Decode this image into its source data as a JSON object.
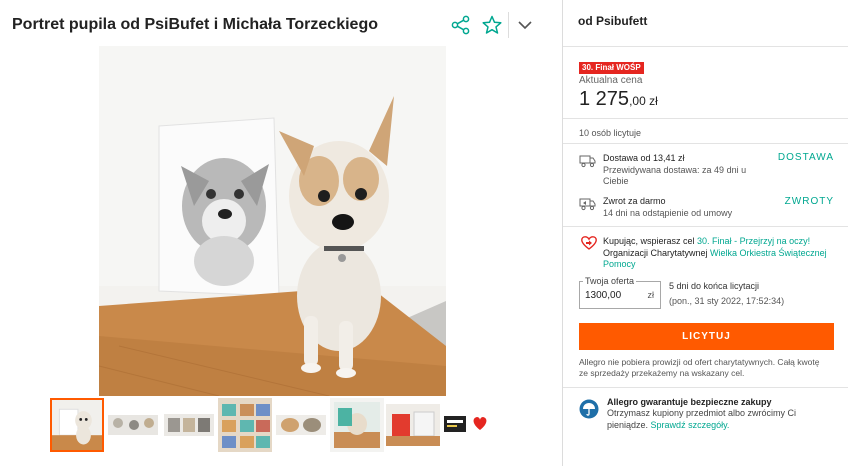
{
  "title": "Portret pupila od PsiBufet i Michała Torzeckiego",
  "header_icons": [
    "share-icon",
    "star-icon",
    "chevron-down-icon"
  ],
  "seller": "od Psibufett",
  "badge": "30. Finał WOŚP",
  "price_label": "Aktualna cena",
  "price": {
    "whole": "1 275",
    "fraction": ",00 zł"
  },
  "bidders": "10 osób licytuje",
  "delivery": {
    "title": "Dostawa od 13,41 zł",
    "sub": "Przewidywana dostawa: za 49 dni u Ciebie",
    "link": "DOSTAWA"
  },
  "returns": {
    "title": "Zwrot za darmo",
    "sub": "14 dni na odstąpienie od umowy",
    "link": "ZWROTY"
  },
  "charity": {
    "prefix": "Kupując, wspierasz cel ",
    "goal_link": "30. Finał - Przejrzyj na oczy!",
    "org_prefix": "Organizacji Charytatywnej ",
    "org_link": "Wielka Orkiestra Świątecznej Pomocy"
  },
  "bid": {
    "legend": "Twoja oferta",
    "value": "1300,00",
    "unit": "zł",
    "time_left": "5 dni do końca licytacji",
    "end_time": "(pon., 31 sty 2022, 17:52:34)"
  },
  "bid_button": "LICYTUJ",
  "note": "Allegro nie pobiera prowizji od ofert charytatywnych. Całą kwotę ze sprzedaży przekażemy na wskazany cel.",
  "guarantee": {
    "title": "Allegro gwarantuje bezpieczne zakupy",
    "text": "Otrzymasz kupiony przedmiot albo zwrócimy Ci pieniądze. ",
    "link": "Sprawdź szczegóły."
  },
  "colors": {
    "accent": "#ff5a00",
    "link": "#00a790",
    "badge": "#e52620"
  }
}
